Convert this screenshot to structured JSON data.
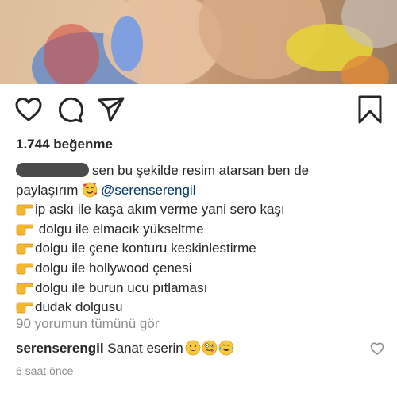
{
  "post": {
    "likes_label": "1.744 beğenme",
    "caption_lines": [
      "sen bu şekilde resim atarsan ben de",
      "paylaşırım",
      "@serenserengil",
      "ip askı ile kaşa akım verme yani  sero kaşı",
      " dolgu ile elmacık yükseltme",
      "dolgu ile çene konturu keskinlestirme",
      "dolgu ile hollywood çenesi",
      "dolgu ile burun ucu pıtlaması",
      "dudak dolgusu"
    ],
    "view_all_comments": "90 yorumun tümünü gör",
    "comment_user": "serenserengil",
    "comment_text": "Sanat eserin",
    "timestamp": "6 saat önce"
  },
  "icons": {
    "like": "heart-outline-icon",
    "comment": "comment-bubble-icon",
    "share": "paper-plane-icon",
    "save": "bookmark-icon",
    "comment_like": "small-heart-icon",
    "caption_emoji": "smiling-face-with-hearts-emoji",
    "pointing_emoji": "backhand-index-pointing-right-emoji",
    "comment_emojis": [
      "grinning-face-emoji",
      "zany-face-emoji",
      "tears-of-joy-emoji"
    ]
  },
  "colors": {
    "text": "#262626",
    "secondary_text": "#8e8e8e",
    "mention": "#003569"
  }
}
